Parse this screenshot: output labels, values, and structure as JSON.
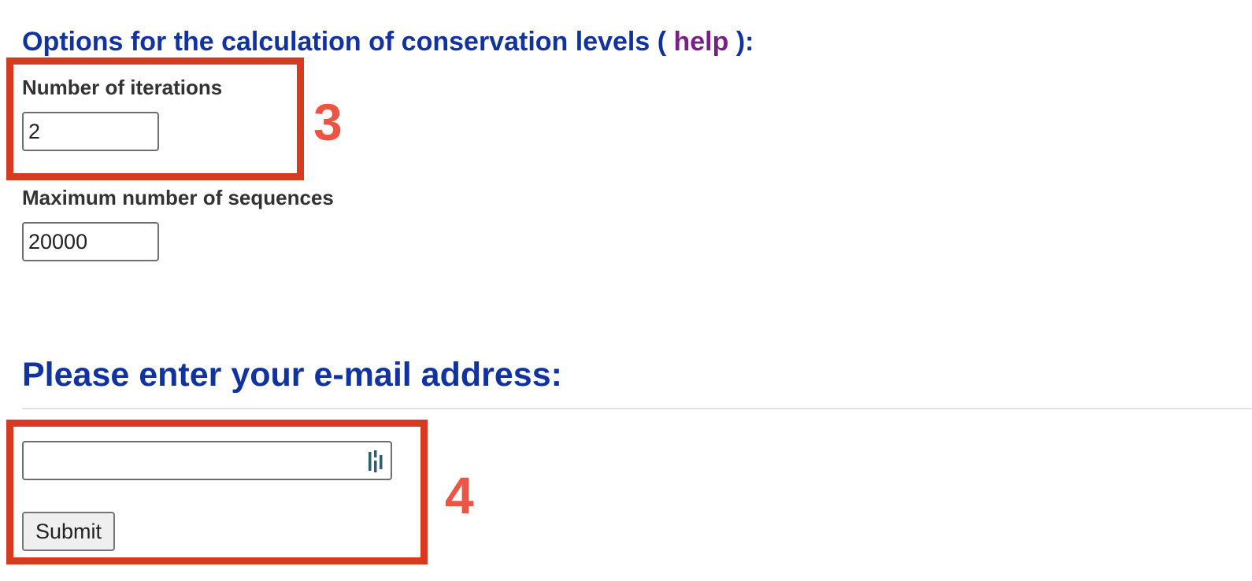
{
  "conservation_options": {
    "title_prefix": "Options for the calculation of conservation levels ( ",
    "help_link": "help",
    "title_suffix": " ):",
    "iterations": {
      "label": "Number of iterations",
      "value": "2"
    },
    "max_sequences": {
      "label": "Maximum number of sequences",
      "value": "20000"
    }
  },
  "email_section": {
    "title": "Please enter your e-mail address:",
    "email_value": "",
    "submit_label": "Submit",
    "field_icon": "password-manager-icon"
  },
  "annotations": {
    "iterations_marker": "3",
    "email_marker": "4",
    "marker_color": "#d63a21"
  }
}
